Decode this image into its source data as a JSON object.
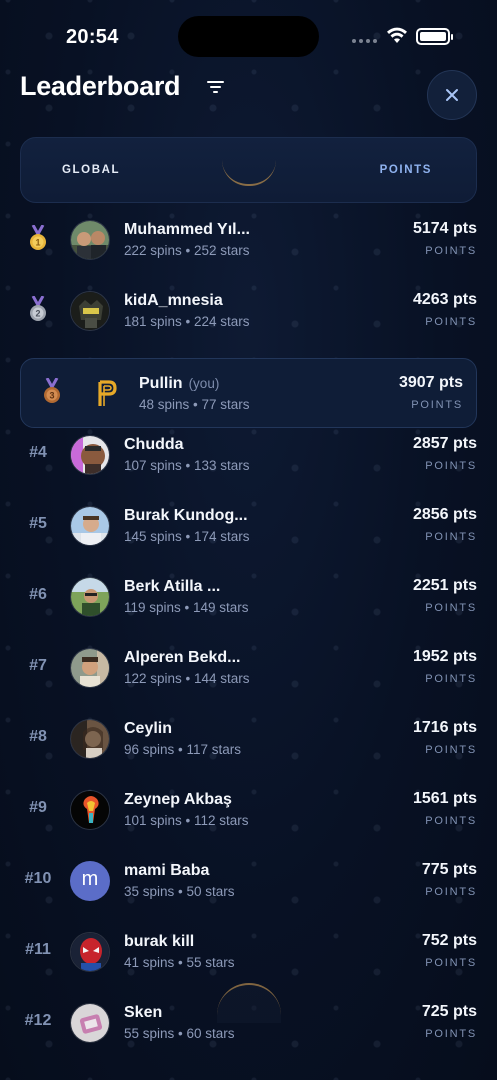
{
  "status_bar": {
    "time": "20:54"
  },
  "header": {
    "title": "Leaderboard"
  },
  "tabs": {
    "scope": "GLOBAL",
    "metric": "POINTS"
  },
  "pts_label": "POINTS",
  "rows": [
    {
      "rank": "1",
      "name": "Muhammed Yıl...",
      "you": "",
      "stats": "222 spins • 252 stars",
      "points": "5174 pts",
      "medal": "gold"
    },
    {
      "rank": "2",
      "name": "kidA_mnesia",
      "you": "",
      "stats": "181 spins • 224 stars",
      "points": "4263 pts",
      "medal": "silver"
    },
    {
      "rank": "3",
      "name": "Pullin",
      "you": "(you)",
      "stats": "48 spins • 77 stars",
      "points": "3907 pts",
      "medal": "bronze"
    },
    {
      "rank": "#4",
      "name": "Chudda",
      "you": "",
      "stats": "107 spins • 133 stars",
      "points": "2857 pts"
    },
    {
      "rank": "#5",
      "name": "Burak Kundog...",
      "you": "",
      "stats": "145 spins • 174 stars",
      "points": "2856 pts"
    },
    {
      "rank": "#6",
      "name": "Berk Atilla ...",
      "you": "",
      "stats": "119 spins • 149 stars",
      "points": "2251 pts"
    },
    {
      "rank": "#7",
      "name": "Alperen Bekd...",
      "you": "",
      "stats": "122 spins • 144 stars",
      "points": "1952 pts"
    },
    {
      "rank": "#8",
      "name": "Ceylin",
      "you": "",
      "stats": "96 spins • 117 stars",
      "points": "1716 pts"
    },
    {
      "rank": "#9",
      "name": "Zeynep Akbaş",
      "you": "",
      "stats": "101 spins • 112 stars",
      "points": "1561 pts"
    },
    {
      "rank": "#10",
      "name": "mami Baba",
      "you": "",
      "stats": "35 spins • 50 stars",
      "points": "775 pts",
      "initial": "m"
    },
    {
      "rank": "#11",
      "name": "burak kill",
      "you": "",
      "stats": "41 spins • 55 stars",
      "points": "752 pts"
    },
    {
      "rank": "#12",
      "name": "Sken",
      "you": "",
      "stats": "55 spins • 60 stars",
      "points": "725 pts"
    }
  ],
  "colors": {
    "accent": "#8fb2ef",
    "background": "#081124",
    "highlight_row": "#0f1d37",
    "gold": "#e7b43a",
    "silver": "#b7bcc6",
    "bronze": "#c57a3e"
  }
}
